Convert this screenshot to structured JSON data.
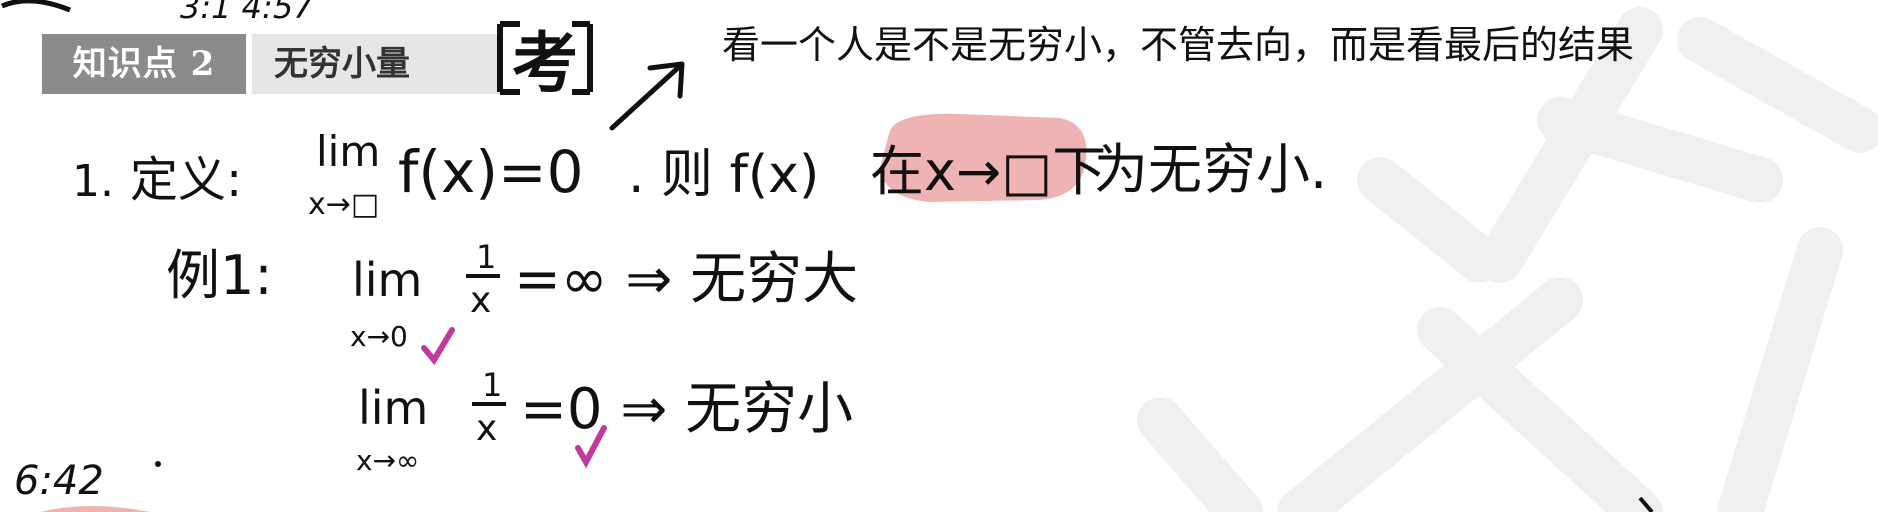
{
  "section": {
    "badge": "知识点 2",
    "title": "无穷小量"
  },
  "note": {
    "text": "看一个人是不是无穷小，不管去向，而是看最后的结果"
  },
  "handwriting": {
    "top_timestamp": "3:1 4:57",
    "stamp": "考",
    "definition": {
      "number": "1.",
      "label": "定义:",
      "lim": "lim",
      "sub": "x→□",
      "expr": "f(x)=0",
      "then": ". 则 f(x)",
      "highlighted": "在x→□下",
      "tail": "为无穷小."
    },
    "example1": {
      "label": "例1:",
      "lim": "lim",
      "sub": "x→0",
      "frac_num": "1",
      "frac_den": "x",
      "result": "=∞ ⇒ 无穷大"
    },
    "example2": {
      "lim": "lim",
      "sub": "x→∞",
      "frac_num": "1",
      "frac_den": "x",
      "result": "=0 ⇒ 无穷小"
    },
    "timestamp": "6:42"
  },
  "colors": {
    "highlight": "#efb3b3",
    "check": "#c03a9a",
    "ink": "#111111",
    "watermark": "#f1f1f1"
  }
}
